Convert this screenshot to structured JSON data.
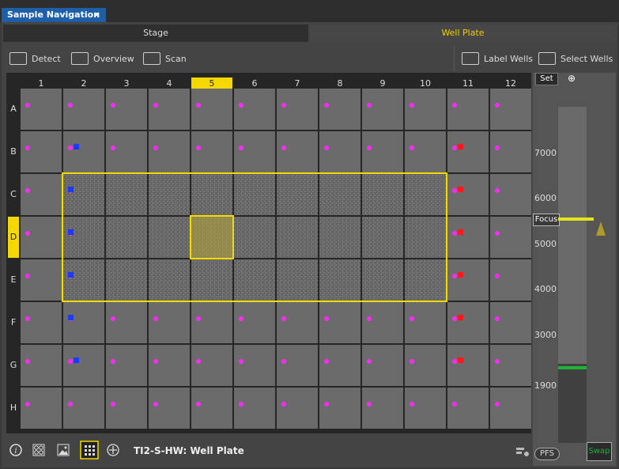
{
  "window": {
    "tab_title": "Sample Navigation",
    "close_glyph": "×"
  },
  "segments": {
    "stage": "Stage",
    "well_plate": "Well Plate"
  },
  "toolbar": {
    "detect": "Detect",
    "overview": "Overview",
    "scan": "Scan",
    "label_wells": "Label Wells",
    "select_wells": "Select Wells"
  },
  "plate": {
    "columns": [
      "1",
      "2",
      "3",
      "4",
      "5",
      "6",
      "7",
      "8",
      "9",
      "10",
      "11",
      "12"
    ],
    "rows": [
      "A",
      "B",
      "C",
      "D",
      "E",
      "F",
      "G",
      "H"
    ],
    "selected_column": "5",
    "selected_row": "D"
  },
  "z_panel": {
    "set": "Set",
    "zoom_icon": "zoom-icon",
    "labels": [
      "7000",
      "6000",
      "5000",
      "4000",
      "3000",
      "1900"
    ],
    "focus": "Focus",
    "pfs": "PFS",
    "swap": "Swap"
  },
  "bottom": {
    "status": "TI2-S-HW: Well Plate"
  },
  "colors": {
    "accent": "#f5d800",
    "tab": "#1f5fa8",
    "marker": "#ff2bff",
    "blue": "#1a3cff",
    "red": "#ff1a1a",
    "green": "#1fb33a"
  }
}
